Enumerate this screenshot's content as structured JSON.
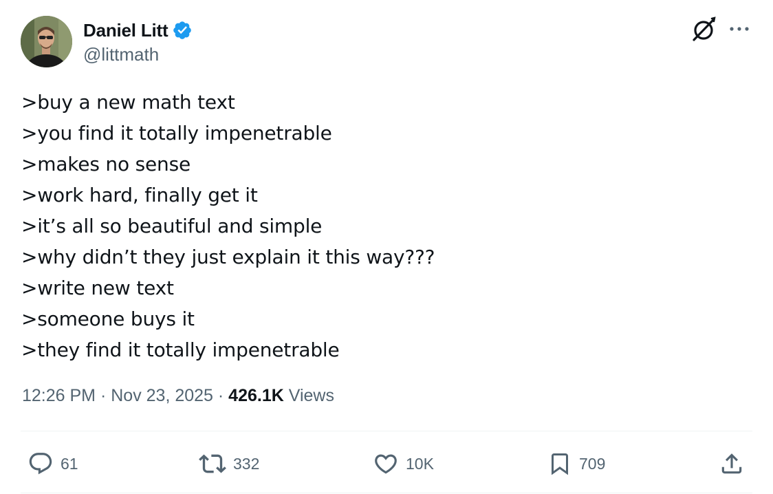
{
  "author": {
    "display_name": "Daniel Litt",
    "handle": "@littmath",
    "verified": true
  },
  "tweet": {
    "lines": [
      ">buy a new math text",
      ">you find it totally impenetrable",
      ">makes no sense",
      ">work hard, finally get it",
      ">it’s all so beautiful and simple",
      ">why didn’t they just explain it this way???",
      ">write new text",
      ">someone buys it",
      ">they find it totally impenetrable"
    ]
  },
  "meta": {
    "time": "12:26 PM",
    "separator": " · ",
    "date": "Nov 23, 2025",
    "views_count": "426.1K",
    "views_label": " Views"
  },
  "actions": {
    "replies": "61",
    "reposts": "332",
    "likes": "10K",
    "bookmarks": "709"
  },
  "icons": {
    "header": [
      "grok-icon",
      "more-options-icon"
    ],
    "actions": [
      "reply-icon",
      "repost-icon",
      "like-icon",
      "bookmark-icon",
      "share-icon"
    ]
  },
  "colors": {
    "text_primary": "#0f1419",
    "text_secondary": "#536471",
    "verified_blue": "#1d9bf0",
    "divider": "#eff3f4"
  }
}
